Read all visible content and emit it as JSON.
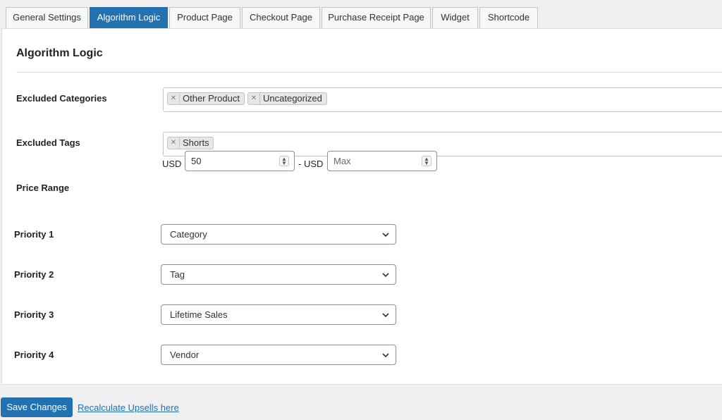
{
  "tabs": [
    {
      "label": "General Settings",
      "active": false
    },
    {
      "label": "Algorithm Logic",
      "active": true
    },
    {
      "label": "Product Page",
      "active": false
    },
    {
      "label": "Checkout Page",
      "active": false
    },
    {
      "label": "Purchase Receipt Page",
      "active": false
    },
    {
      "label": "Widget",
      "active": false
    },
    {
      "label": "Shortcode",
      "active": false
    }
  ],
  "section": {
    "title": "Algorithm Logic"
  },
  "excluded_categories": {
    "label": "Excluded Categories",
    "chips": [
      "Other Product",
      "Uncategorized"
    ]
  },
  "excluded_tags": {
    "label": "Excluded Tags",
    "chips": [
      "Shorts"
    ]
  },
  "price_range": {
    "label": "Price Range",
    "currency_min": "USD",
    "separator": "- USD",
    "min_value": "50",
    "max_placeholder": "Max"
  },
  "priorities": [
    {
      "label": "Priority 1",
      "value": "Category"
    },
    {
      "label": "Priority 2",
      "value": "Tag"
    },
    {
      "label": "Priority 3",
      "value": "Lifetime Sales"
    },
    {
      "label": "Priority 4",
      "value": "Vendor"
    }
  ],
  "footer": {
    "save_label": "Save Changes",
    "recalc_label": "Recalculate Upsells here"
  },
  "icons": {
    "chip_remove": "close-icon",
    "spinner": "spinner-icon",
    "select": "chevron-down-icon"
  },
  "colors": {
    "accent": "#2271b1",
    "page_bg": "#f0f0f1",
    "panel_bg": "#ffffff"
  }
}
